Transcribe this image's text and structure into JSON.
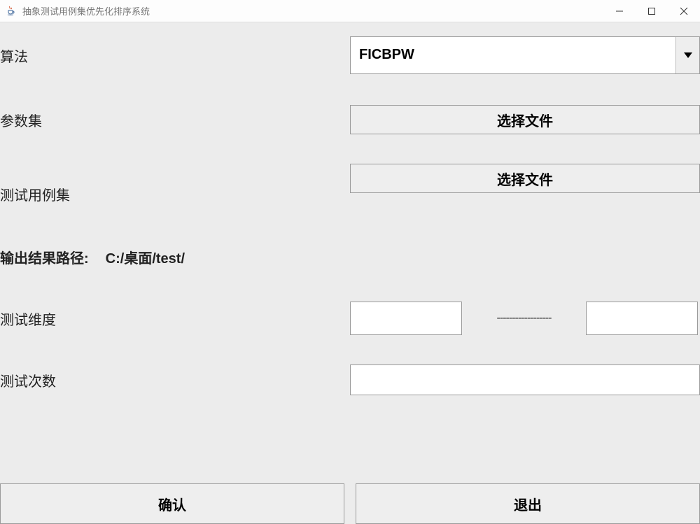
{
  "titlebar": {
    "title": "抽象测试用例集优先化排序系统"
  },
  "form": {
    "algorithm_label": "算法",
    "algorithm_value": "FICBPW",
    "paramset_label": "参数集",
    "paramset_button": "选择文件",
    "testcase_label": "测试用例集",
    "testcase_button": "选择文件",
    "output_path_label": "输出结果路径:",
    "output_path_value": "C:/桌面/test/",
    "dimension_label": "测试维度",
    "dimension_from": "",
    "dimension_sep": "------------------",
    "dimension_to": "",
    "count_label": "测试次数",
    "count_value": ""
  },
  "buttons": {
    "confirm": "确认",
    "exit": "退出"
  }
}
